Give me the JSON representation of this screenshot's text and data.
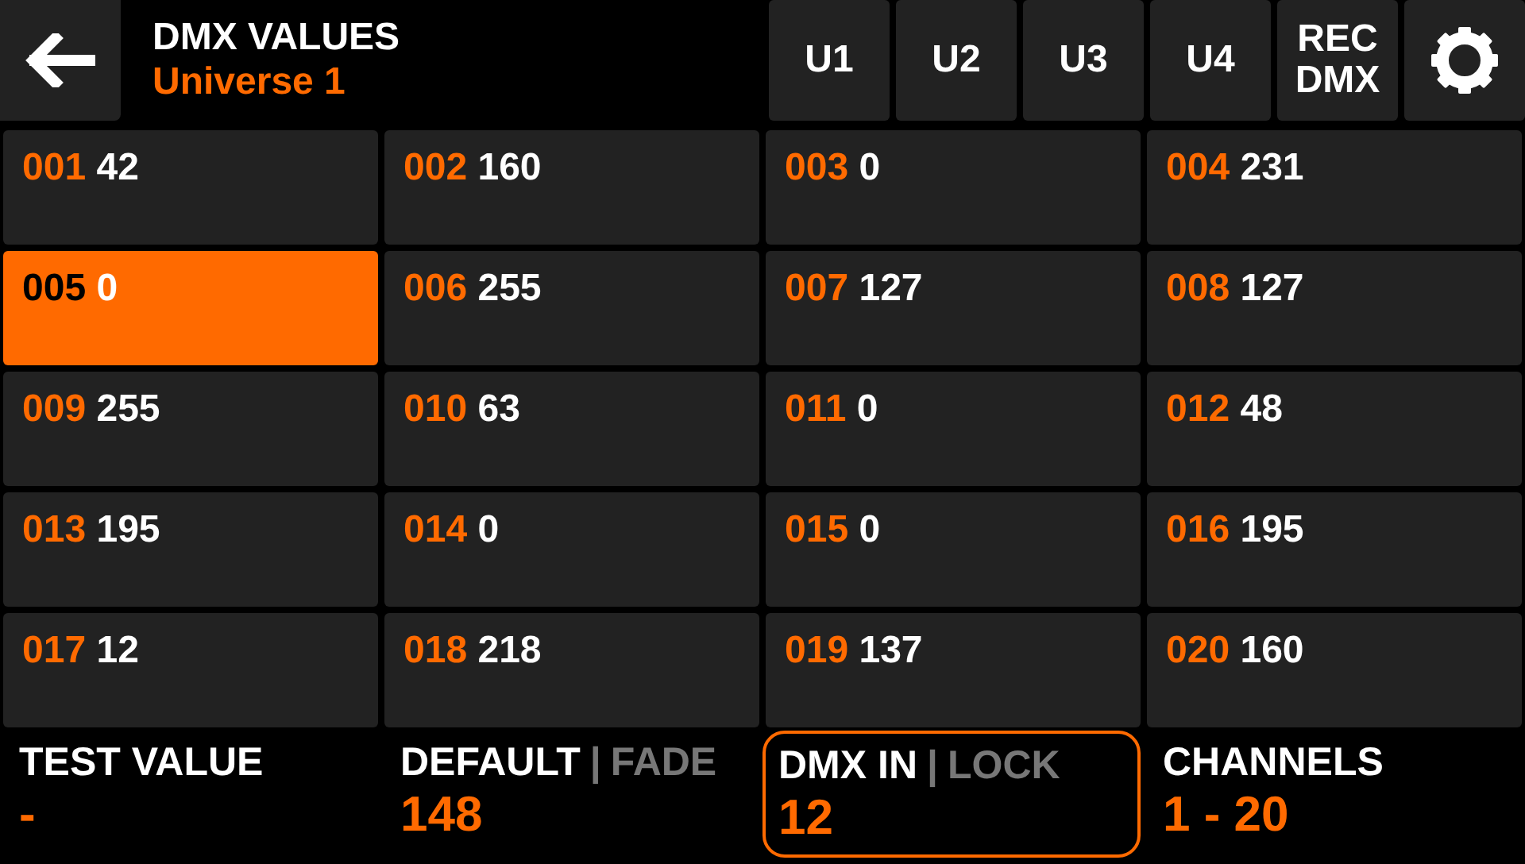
{
  "header": {
    "title": "DMX VALUES",
    "subtitle": "Universe 1"
  },
  "tabs": [
    {
      "label": "U1"
    },
    {
      "label": "U2"
    },
    {
      "label": "U3"
    },
    {
      "label": "U4"
    },
    {
      "label": "REC DMX"
    }
  ],
  "channels": [
    {
      "channel": "001",
      "value": "42",
      "selected": false
    },
    {
      "channel": "002",
      "value": "160",
      "selected": false
    },
    {
      "channel": "003",
      "value": "0",
      "selected": false
    },
    {
      "channel": "004",
      "value": "231",
      "selected": false
    },
    {
      "channel": "005",
      "value": "0",
      "selected": true
    },
    {
      "channel": "006",
      "value": "255",
      "selected": false
    },
    {
      "channel": "007",
      "value": "127",
      "selected": false
    },
    {
      "channel": "008",
      "value": "127",
      "selected": false
    },
    {
      "channel": "009",
      "value": "255",
      "selected": false
    },
    {
      "channel": "010",
      "value": "63",
      "selected": false
    },
    {
      "channel": "011",
      "value": "0",
      "selected": false
    },
    {
      "channel": "012",
      "value": "48",
      "selected": false
    },
    {
      "channel": "013",
      "value": "195",
      "selected": false
    },
    {
      "channel": "014",
      "value": "0",
      "selected": false
    },
    {
      "channel": "015",
      "value": "0",
      "selected": false
    },
    {
      "channel": "016",
      "value": "195",
      "selected": false
    },
    {
      "channel": "017",
      "value": "12",
      "selected": false
    },
    {
      "channel": "018",
      "value": "218",
      "selected": false
    },
    {
      "channel": "019",
      "value": "137",
      "selected": false
    },
    {
      "channel": "020",
      "value": "160",
      "selected": false
    }
  ],
  "footer": [
    {
      "options": [
        {
          "label": "TEST VALUE",
          "selected": true
        }
      ],
      "value": "-",
      "framed": false
    },
    {
      "options": [
        {
          "label": "DEFAULT",
          "selected": true
        },
        {
          "label": "FADE",
          "selected": false
        }
      ],
      "separator": "|",
      "value": "148",
      "framed": false
    },
    {
      "options": [
        {
          "label": "DMX IN",
          "selected": true
        },
        {
          "label": "LOCK",
          "selected": false
        }
      ],
      "separator": "|",
      "value": "12",
      "framed": true
    },
    {
      "options": [
        {
          "label": "CHANNELS",
          "selected": true
        }
      ],
      "value": "1 - 20",
      "framed": false
    }
  ]
}
